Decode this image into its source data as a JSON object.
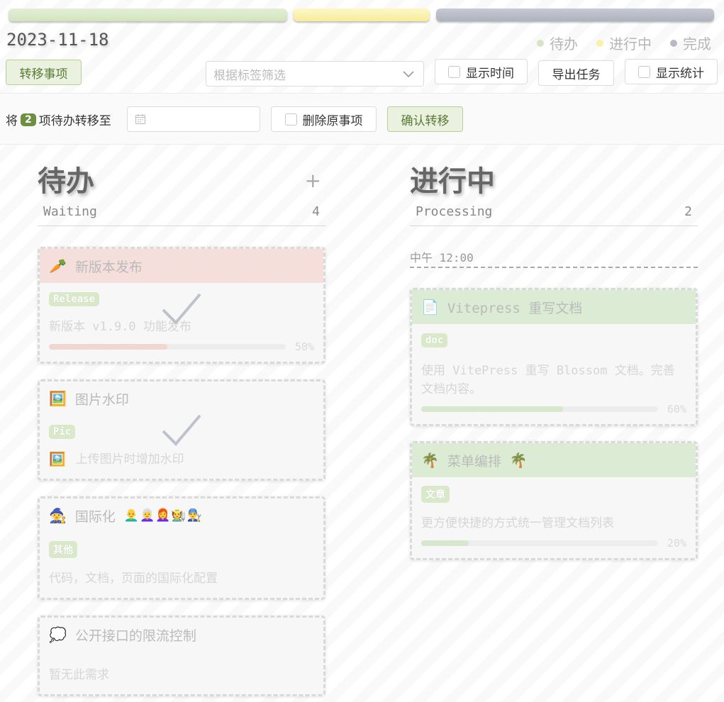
{
  "status_colors": {
    "waiting": "#d9e8c9",
    "processing": "#fbf3b5",
    "done": "#b9bcc6"
  },
  "date": "2023-11-18",
  "legend": [
    {
      "label": "待办",
      "color": "#d6e6c5"
    },
    {
      "label": "进行中",
      "color": "#fbf0a8"
    },
    {
      "label": "完成",
      "color": "#b7bac4"
    }
  ],
  "toolbar": {
    "transfer_button": "转移事项",
    "tag_filter_placeholder": "根据标签筛选",
    "show_time_label": "显示时间",
    "export_button": "导出任务",
    "show_stats_label": "显示统计"
  },
  "transfer": {
    "prefix": "将",
    "count": "2",
    "suffix": "项待办转移至",
    "delete_original_label": "删除原事项",
    "confirm_button": "确认转移"
  },
  "columns": {
    "waiting": {
      "title": "待办",
      "subtitle": "Waiting",
      "count": "4",
      "add": "+",
      "cards": [
        {
          "emoji": "🥕",
          "title": "新版本发布",
          "tag": "Release",
          "content": "新版本 v1.9.0 功能发布",
          "progress": 50,
          "progress_label": "50%",
          "color": "#f1d2cd"
        },
        {
          "emoji": "🖼️",
          "title": "图片水印",
          "tag": "Pic",
          "content": "上传图片时增加水印",
          "content_emoji": "🖼️"
        },
        {
          "emoji": "🧙",
          "title": "国际化",
          "title_emojis": "👨‍🦲👩‍🦳👩‍🦰🧑‍🌾👨‍🔧",
          "tag": "其他",
          "content": "代码，文档，页面的国际化配置"
        },
        {
          "emoji": "💭",
          "title": "公开接口的限流控制",
          "content": "暂无此需求"
        }
      ]
    },
    "processing": {
      "title": "进行中",
      "subtitle": "Processing",
      "count": "2",
      "time_separator": "中午 12:00",
      "cards": [
        {
          "emoji": "📄",
          "title": "Vitepress 重写文档",
          "tag": "doc",
          "content": "使用 VitePress 重写 Blossom 文档。完善文档内容。",
          "progress": 60,
          "progress_label": "60%",
          "color": "#d2e6c8"
        },
        {
          "emoji": "🌴",
          "title": "菜单编排",
          "title_suffix_emoji": "🌴",
          "tag": "文章",
          "content": "更方便快捷的方式统一管理文档列表",
          "progress": 20,
          "progress_label": "20%",
          "color": "#d2e6c8"
        }
      ]
    }
  }
}
